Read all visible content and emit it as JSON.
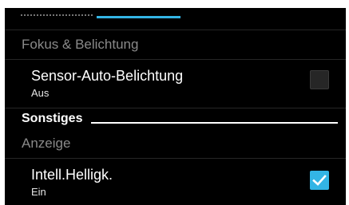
{
  "categories": {
    "focus_exposure": "Fokus & Belichtung",
    "display": "Anzeige"
  },
  "sections": {
    "misc": "Sonstiges"
  },
  "preferences": {
    "sensor_auto_exposure": {
      "title": "Sensor-Auto-Belichtung",
      "summary": "Aus",
      "checked": false
    },
    "intelligent_brightness": {
      "title": "Intell.Helligk.",
      "summary": "Ein",
      "checked": true
    }
  },
  "colors": {
    "accent": "#33b5e5",
    "background": "#000000",
    "category_text": "#8a8a8a",
    "divider": "#262626"
  },
  "icons": {
    "checkmark": "check-icon"
  }
}
